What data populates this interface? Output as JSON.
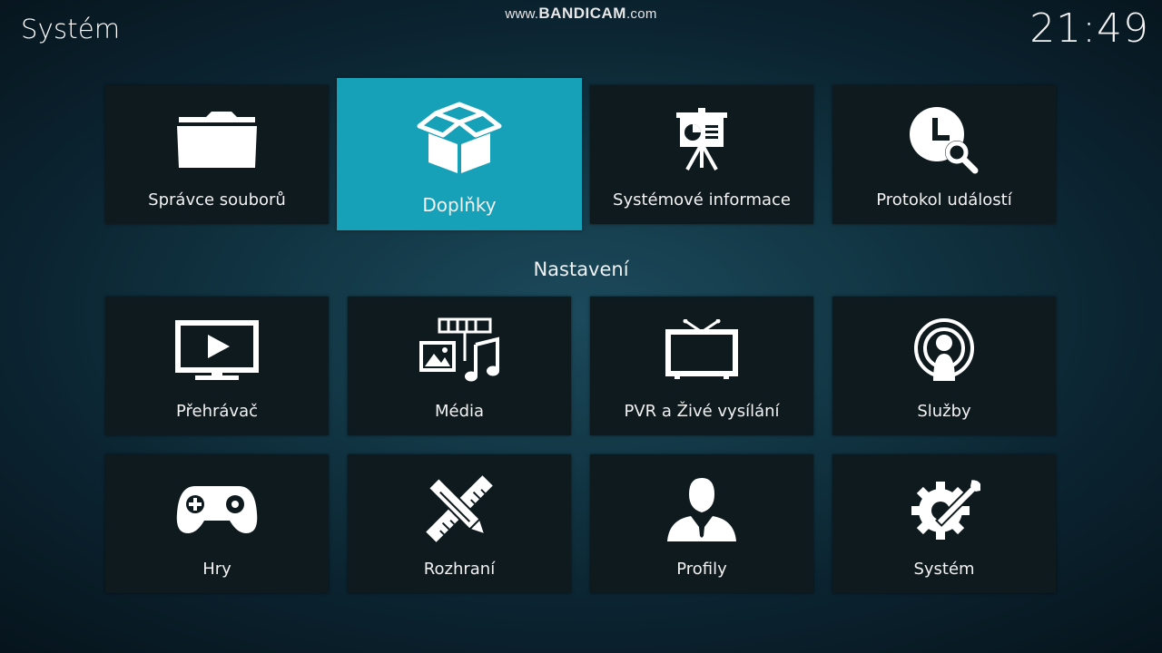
{
  "header": {
    "title": "Systém",
    "clock": "21:49"
  },
  "watermark": {
    "prefix": "www.",
    "brand": "BANDICAM",
    "suffix": ".com"
  },
  "top_row": [
    {
      "label": "Správce souborů",
      "icon": "folder-icon"
    },
    {
      "label": "Doplňky",
      "icon": "open-box-icon",
      "focused": true
    },
    {
      "label": "Systémové informace",
      "icon": "presentation-board-icon"
    },
    {
      "label": "Protokol událostí",
      "icon": "clock-search-icon"
    }
  ],
  "section": {
    "label": "Nastavení"
  },
  "settings_row_1": [
    {
      "label": "Přehrávač",
      "icon": "tv-play-icon"
    },
    {
      "label": "Média",
      "icon": "media-icon"
    },
    {
      "label": "PVR a Živé vysílání",
      "icon": "tv-antenna-icon"
    },
    {
      "label": "Služby",
      "icon": "broadcast-person-icon"
    }
  ],
  "settings_row_2": [
    {
      "label": "Hry",
      "icon": "gamepad-icon"
    },
    {
      "label": "Rozhraní",
      "icon": "pencil-ruler-icon"
    },
    {
      "label": "Profily",
      "icon": "user-profile-icon"
    },
    {
      "label": "Systém",
      "icon": "gear-wrench-icon"
    }
  ],
  "colors": {
    "focus_accent": "#16a1b8",
    "tile_background": "#0f1a1f",
    "background": "#123644"
  }
}
